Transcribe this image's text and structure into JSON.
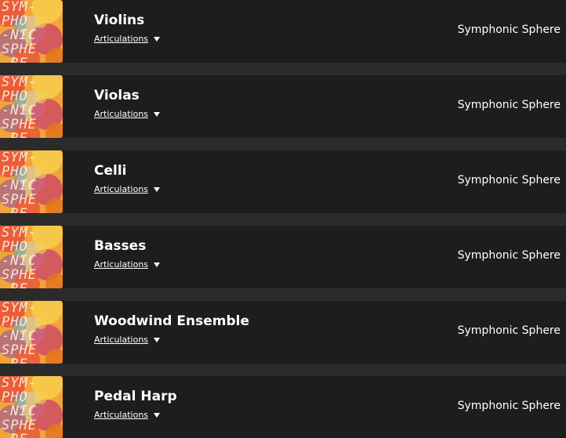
{
  "thumbnail": {
    "icon": "symphonic-sphere-cover-art",
    "lines": [
      "SYM-",
      "PHO",
      "-NIC",
      "SPHE",
      "-RE"
    ],
    "colors": [
      "#e8523a",
      "#f2a33b",
      "#f6d04d",
      "#c93a6d",
      "#8a4fa3",
      "#4fa0b9",
      "#d9c9a3",
      "#e4761f"
    ]
  },
  "items": [
    {
      "title": "Violins",
      "articulations_label": "Articulations",
      "publisher": "Symphonic Sphere"
    },
    {
      "title": "Violas",
      "articulations_label": "Articulations",
      "publisher": "Symphonic Sphere"
    },
    {
      "title": "Celli",
      "articulations_label": "Articulations",
      "publisher": "Symphonic Sphere"
    },
    {
      "title": "Basses",
      "articulations_label": "Articulations",
      "publisher": "Symphonic Sphere"
    },
    {
      "title": "Woodwind Ensemble",
      "articulations_label": "Articulations",
      "publisher": "Symphonic Sphere"
    },
    {
      "title": "Pedal Harp",
      "articulations_label": "Articulations",
      "publisher": "Symphonic Sphere"
    }
  ]
}
